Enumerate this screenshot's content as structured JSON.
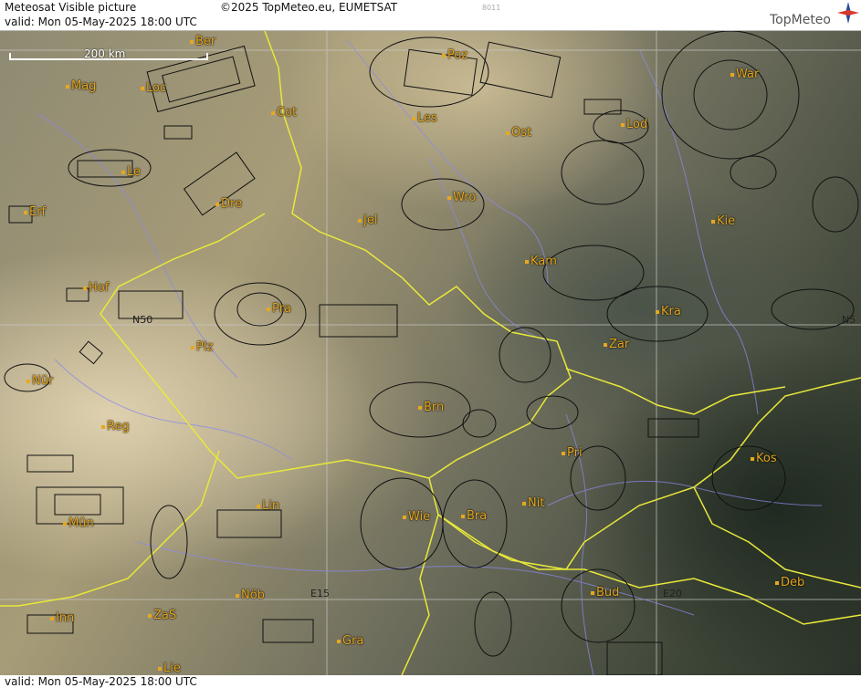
{
  "header": {
    "title": "Meteosat Visible picture",
    "copyright": "©2025 TopMeteo.eu, EUMETSAT",
    "valid": "valid:  Mon  05-May-2025  18:00 UTC",
    "code": "8011",
    "logo": "TopMeteo"
  },
  "footer": {
    "valid": "valid:  Mon  05-May-2025  18:00 UTC"
  },
  "scale": {
    "label": "200 km"
  },
  "grid_labels": {
    "n50": "N50",
    "n50_right": "N5",
    "e15": "E15",
    "e20": "E20"
  },
  "cities": [
    "Ber",
    "Mag",
    "Loc",
    "Cot",
    "Poz",
    "Les",
    "Ost",
    "Lod",
    "War",
    "Le",
    "Dre",
    "Wro",
    "Erf",
    "Jel",
    "Kie",
    "Kam",
    "Hof",
    "Pra",
    "Kra",
    "Plz",
    "Zar",
    "Nür",
    "Brn",
    "Reg",
    "Pri",
    "Kos",
    "Nit",
    "Lin",
    "Mün",
    "Wie",
    "Bra",
    "Nöb",
    "Bud",
    "Deb",
    "Inn",
    "ZaS",
    "Gra",
    "Lie"
  ],
  "colors": {
    "border": "#e8e83a",
    "rivers": "#8a8ae8",
    "city": "#e6a81e",
    "grid": "#c8c8c8",
    "outline": "#111111"
  }
}
